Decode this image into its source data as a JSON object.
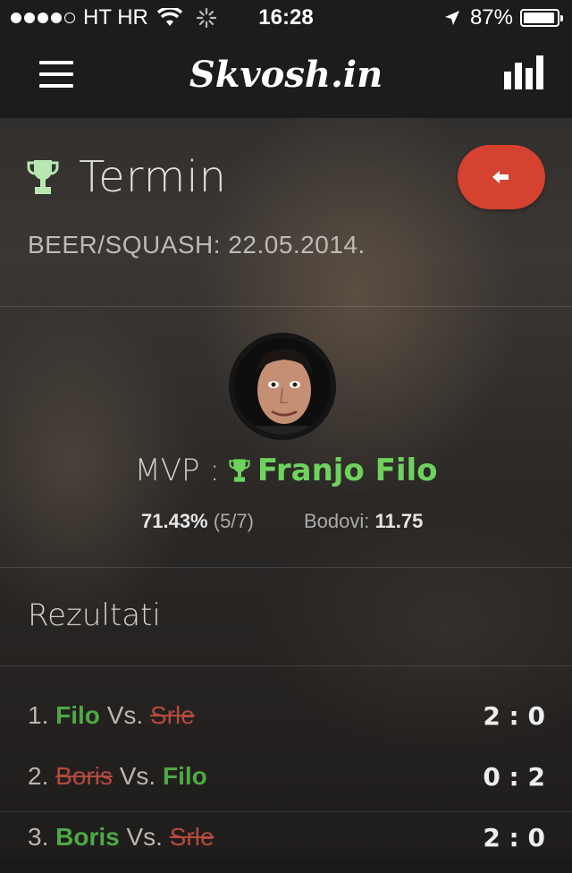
{
  "status_bar": {
    "carrier": "HT HR",
    "time": "16:28",
    "battery": "87%"
  },
  "navbar": {
    "brand": "Skvosh.in",
    "menu_icon": "hamburger-icon",
    "stats_icon": "bar-chart-icon"
  },
  "header": {
    "title": "Termin",
    "subtitle": "BEER/SQUASH: 22.05.2014.",
    "back_icon": "arrow-left-icon"
  },
  "mvp": {
    "label": "MVP :",
    "name": "Franjo Filo",
    "percentage": "71.43%",
    "ratio": "(5/7)",
    "points_label": "Bodovi:",
    "points_value": "11.75"
  },
  "results": {
    "title": "Rezultati",
    "items": [
      {
        "index": "1.",
        "player1": "Filo",
        "p1_status": "win",
        "vs": "Vs.",
        "player2": "Srle",
        "p2_status": "lose",
        "score": "2 : 0"
      },
      {
        "index": "2.",
        "player1": "Boris",
        "p1_status": "lose",
        "vs": "Vs.",
        "player2": "Filo",
        "p2_status": "win",
        "score": "0 : 2"
      },
      {
        "index": "3.",
        "player1": "Boris",
        "p1_status": "win",
        "vs": "Vs.",
        "player2": "Srle",
        "p2_status": "lose",
        "score": "2 : 0"
      }
    ]
  },
  "colors": {
    "accent_red": "#d5422f",
    "win_green": "#4ea946",
    "mvp_green": "#6dd35e",
    "lose_red": "#b44a3f",
    "trophy_green": "#b7e8b0"
  }
}
